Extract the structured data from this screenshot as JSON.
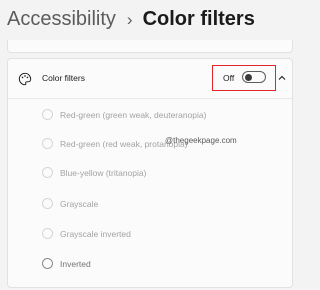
{
  "breadcrumb": {
    "parent": "Accessibility",
    "separator": "›",
    "current": "Color filters"
  },
  "color_filters": {
    "icon": "color-filter-icon",
    "title": "Color filters",
    "toggle": {
      "label": "Off",
      "state": "off"
    },
    "expand_icon": "chevron-up-icon",
    "highlight_color": "#e3262b",
    "options": [
      {
        "label": "Red-green (green weak, deuteranopia)"
      },
      {
        "label": "Red-green (red weak, protanopia)"
      },
      {
        "label": "Blue-yellow (tritanopia)"
      },
      {
        "label": "Grayscale"
      },
      {
        "label": "Grayscale inverted"
      },
      {
        "label": "Inverted"
      }
    ]
  },
  "watermark": "@thegeekpage.com"
}
